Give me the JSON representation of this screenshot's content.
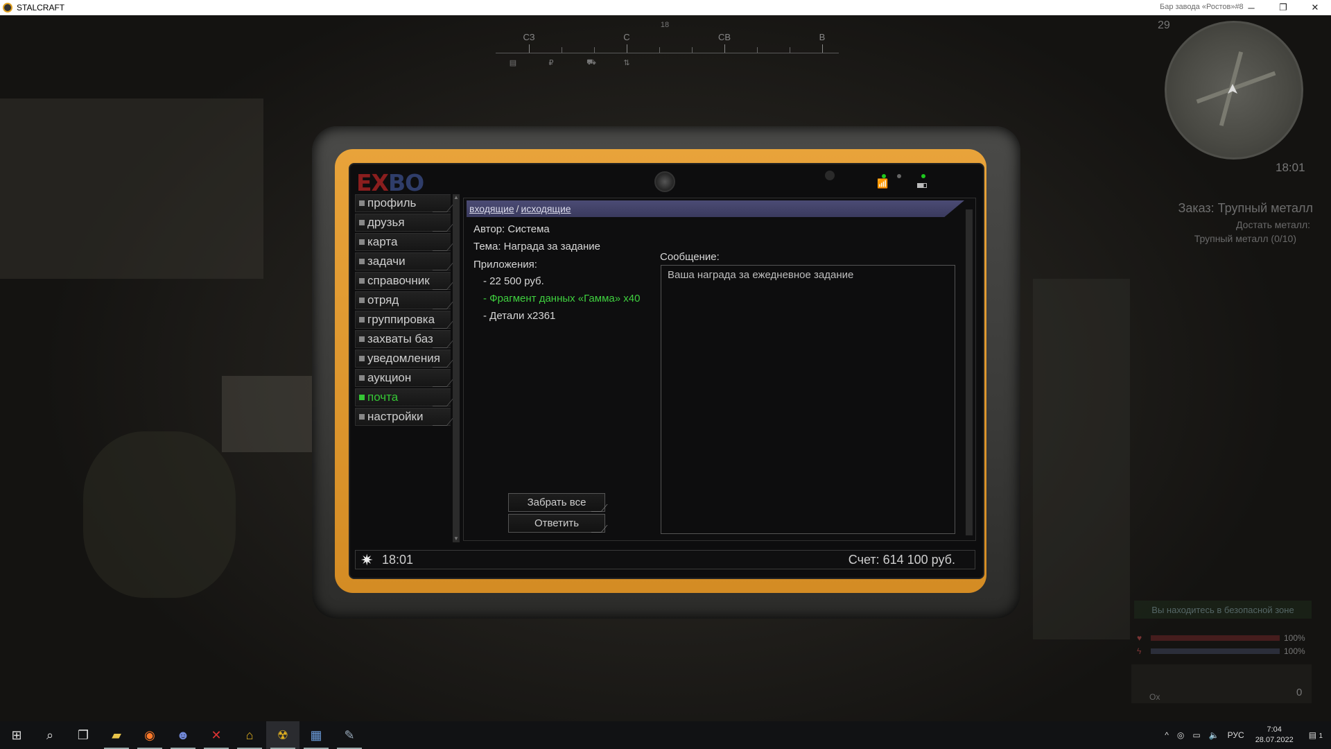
{
  "window": {
    "title": "STALCRAFT",
    "minimize": "─",
    "restore": "❐",
    "close": "✕"
  },
  "compass": {
    "degree": "18",
    "directions": [
      {
        "label": "СЗ",
        "key": "nw"
      },
      {
        "label": "С",
        "key": "n"
      },
      {
        "label": "СВ",
        "key": "ne"
      },
      {
        "label": "В",
        "key": "e"
      }
    ],
    "icons": [
      "▤",
      "₽",
      "⛟",
      "⇅"
    ]
  },
  "hud": {
    "location": "Бар завода «Ростов»#8",
    "minimap_number": "29",
    "minimap_time": "18:01",
    "order_title": "Заказ: Трупный металл",
    "order_line1": "Достать металл:",
    "order_line2": "Трупный металл (0/10)",
    "safe_zone": "Вы находитесь в безопасной зоне",
    "health_pct": "100%",
    "stamina_pct": "100%",
    "health_value": 1.0,
    "stamina_value": 1.0,
    "zero": "0",
    "ox": "Ox"
  },
  "tablet": {
    "logo_left": "EX",
    "logo_right": "BO",
    "nav": [
      {
        "label": "профиль",
        "active": false
      },
      {
        "label": "друзья",
        "active": false
      },
      {
        "label": "карта",
        "active": false
      },
      {
        "label": "задачи",
        "active": false
      },
      {
        "label": "справочник",
        "active": false
      },
      {
        "label": "отряд",
        "active": false
      },
      {
        "label": "группировка",
        "active": false
      },
      {
        "label": "захваты баз",
        "active": false
      },
      {
        "label": "уведомления",
        "active": false
      },
      {
        "label": "аукцион",
        "active": false
      },
      {
        "label": "почта",
        "active": true
      },
      {
        "label": "настройки",
        "active": false
      }
    ],
    "mail": {
      "tab_inbox": "входящие",
      "tab_sep": "/",
      "tab_outbox": "исходящие",
      "author": "Автор: Система",
      "subject": "Тема: Награда за задание",
      "attachments_label": "Приложения:",
      "attachments": [
        {
          "text": "- 22 500 руб.",
          "highlight": false
        },
        {
          "text": "- Фрагмент данных «Гамма» x40",
          "highlight": true
        },
        {
          "text": "- Детали x2361",
          "highlight": false
        }
      ],
      "message_label": "Сообщение:",
      "message_text": "Ваша награда за ежедневное задание",
      "btn_take_all": "Забрать все",
      "btn_reply": "Ответить"
    },
    "status": {
      "time": "18:01",
      "balance": "Счет: 614 100 руб."
    }
  },
  "taskbar": {
    "apps": [
      {
        "name": "start",
        "icon": "⊞"
      },
      {
        "name": "search",
        "icon": "⌕"
      },
      {
        "name": "task-view",
        "icon": "❐"
      },
      {
        "name": "explorer",
        "icon": "▰"
      },
      {
        "name": "firefox",
        "icon": "◉"
      },
      {
        "name": "discord",
        "icon": "☻"
      },
      {
        "name": "media-app",
        "icon": "✕"
      },
      {
        "name": "exbo-launcher",
        "icon": "⌂"
      },
      {
        "name": "stalcraft",
        "icon": "☢"
      },
      {
        "name": "app-window",
        "icon": "▦"
      },
      {
        "name": "tool-app",
        "icon": "✎"
      }
    ],
    "tray": {
      "chevron": "^",
      "lang": "РУС",
      "time": "7:04",
      "date": "28.07.2022",
      "notif_count": "1"
    }
  }
}
